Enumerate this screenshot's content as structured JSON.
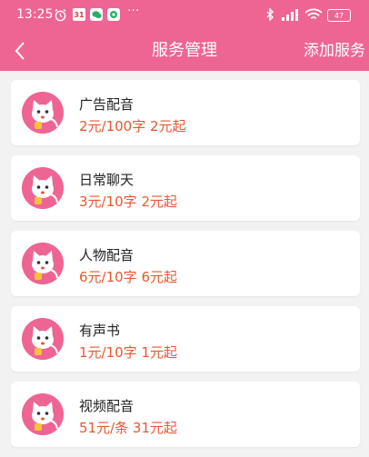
{
  "status_bar": {
    "time": "13:25",
    "battery": "47",
    "calendar_badge": "31",
    "more": "···",
    "icons": [
      "alarm-clock-icon",
      "calendar-icon",
      "wechat-icon",
      "green-app-icon",
      "bluetooth-icon",
      "signal-icon",
      "wifi-icon",
      "battery-icon"
    ]
  },
  "header": {
    "back_icon": "chevron-left-icon",
    "title": "服务管理",
    "action": "添加服务"
  },
  "services": [
    {
      "name": "广告配音",
      "price": "2元/100字 2元起"
    },
    {
      "name": "日常聊天",
      "price": "3元/10字 2元起"
    },
    {
      "name": "人物配音",
      "price": "6元/10字 6元起"
    },
    {
      "name": "有声书",
      "price": "1元/10字 1元起"
    },
    {
      "name": "视频配音",
      "price": "51元/条 31元起"
    }
  ],
  "colors": {
    "accent": "#ee6593",
    "price": "#e9562f",
    "background": "#f2f2f2",
    "card": "#ffffff"
  }
}
